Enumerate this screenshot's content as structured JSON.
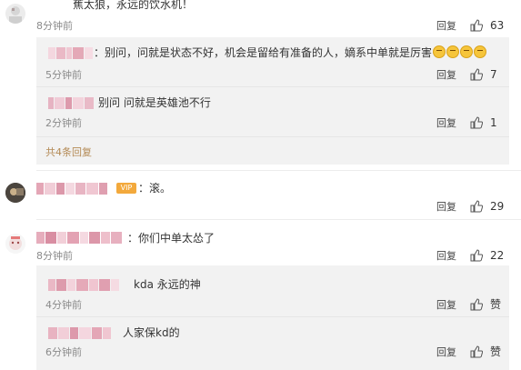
{
  "actions": {
    "reply_label": "回复",
    "like_label": "赞"
  },
  "comment1": {
    "text": "蕉太狼，永远的饮水机！",
    "time": "8分钟前",
    "likes": "63"
  },
  "sub1": {
    "text": "：别问，问就是状态不好，机会是留给有准备的人，嫡系中单就是厉害",
    "time": "5分钟前",
    "likes": "7"
  },
  "sub2": {
    "text": "别问 问就是英雄池不行",
    "time": "2分钟前",
    "likes": "1"
  },
  "more_replies": "共4条回复",
  "comment2": {
    "text": "：滚。",
    "time": "8分钟前",
    "likes": "29",
    "badge_icon": "vip-badge-icon"
  },
  "comment3": {
    "text": "：你们中单太怂了",
    "time": "8分钟前",
    "likes": "22"
  },
  "sub3": {
    "text": "kda 永远的神",
    "time": "4分钟前"
  },
  "sub4": {
    "text": "人家保kd的",
    "time": "6分钟前"
  },
  "colors": {
    "link": "#b48a55",
    "reply_bg": "#f2f2f2",
    "time": "#8a8a8a"
  }
}
